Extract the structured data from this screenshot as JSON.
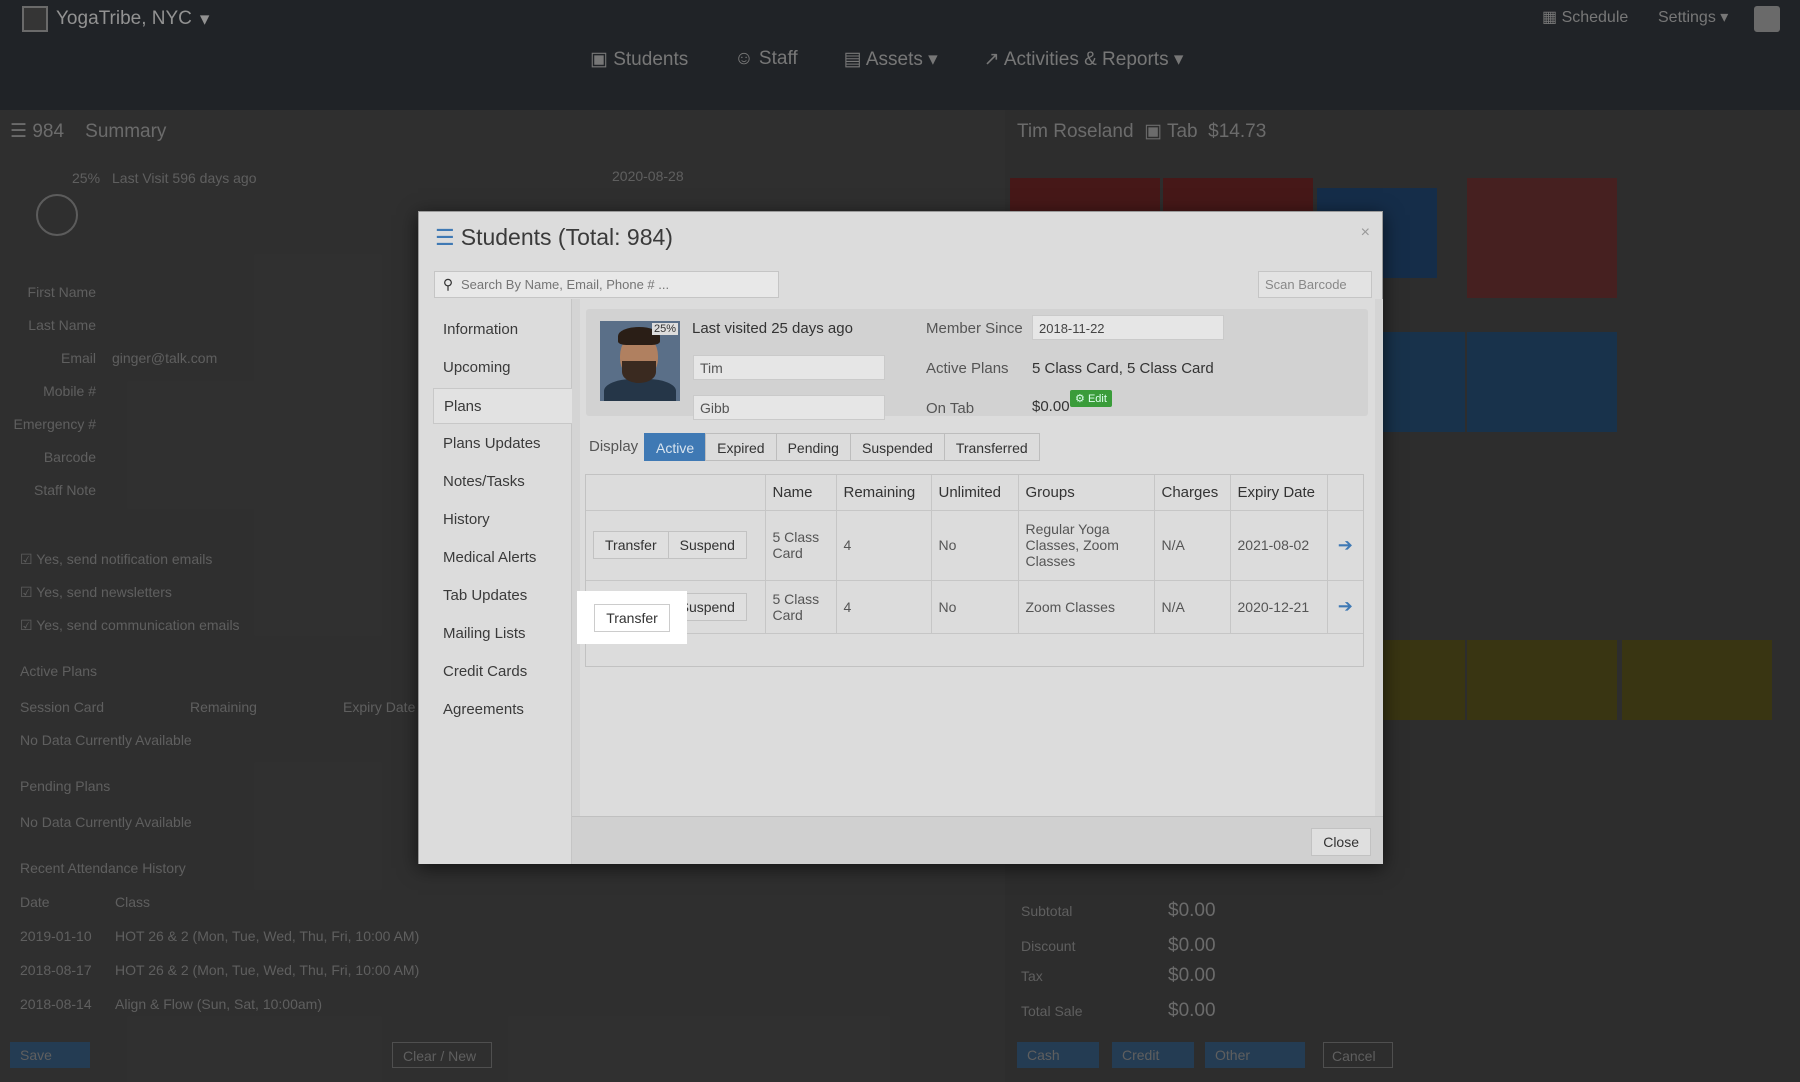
{
  "background": {
    "brand": "YogaTribe, NYC",
    "nav": [
      "Students",
      "Staff",
      "Assets",
      "Activities & Reports"
    ],
    "top_right": [
      "Schedule",
      "Settings"
    ],
    "left_header": {
      "count": "984",
      "title": "Summary"
    },
    "right_header": {
      "name": "Tim Roseland",
      "tab": "Tab",
      "amount": "$14.73"
    },
    "profile_pct": "25%",
    "last_visit": "Last Visit  596 days ago",
    "date": "2020-08-28",
    "fields": [
      "First Name",
      "Last Name",
      "Email",
      "Mobile #",
      "Emergency #",
      "Barcode",
      "Staff Note"
    ],
    "email": "ginger@talk.com",
    "checkboxes": [
      "Yes, send notification emails",
      "Yes, send newsletters",
      "Yes, send communication emails"
    ],
    "active_plans": "Active Plans",
    "plan_cols": [
      "Session Card",
      "Remaining",
      "Expiry Date"
    ],
    "no_data": "No Data Currently Available",
    "pending_plans": "Pending Plans",
    "attendance": "Recent Attendance History",
    "att_cols": [
      "Date",
      "Class"
    ],
    "att_rows": [
      [
        "2019-01-10",
        "HOT 26 & 2 (Mon, Tue, Wed, Thu, Fri, 10:00 AM)"
      ],
      [
        "2018-08-17",
        "HOT 26 & 2 (Mon, Tue, Wed, Thu, Fri, 10:00 AM)"
      ],
      [
        "2018-08-14",
        "Align & Flow (Sun, Sat, 10:00am)"
      ]
    ],
    "save": "Save",
    "clear": "Clear / New",
    "totals_labels": [
      "Subtotal",
      "Discount",
      "Tax",
      "Total Sale"
    ],
    "totals_values": [
      "$0.00",
      "$0.00",
      "$0.00",
      "$0.00"
    ],
    "pay_buttons": [
      "Cash",
      "Credit",
      "Other",
      "Cancel"
    ]
  },
  "modal": {
    "title": "Students (Total: 984)",
    "search_placeholder": "Search By Name, Email, Phone # ...",
    "scan_barcode": "Scan Barcode",
    "menu": [
      "Information",
      "Upcoming",
      "Plans",
      "Plans Updates",
      "Notes/Tasks",
      "History",
      "Medical Alerts",
      "Tab Updates",
      "Mailing Lists",
      "Credit Cards",
      "Agreements"
    ],
    "active_menu": "Plans",
    "profile": {
      "pct": "25%",
      "last_visited": "Last visited 25 days ago",
      "first_name": "Tim",
      "last_name": "Gibb",
      "member_since_label": "Member Since",
      "member_since": "2018-11-22",
      "active_plans_label": "Active Plans",
      "active_plans": "5 Class Card, 5 Class Card",
      "on_tab_label": "On Tab",
      "on_tab": "$0.00",
      "edit": "Edit"
    },
    "display_label": "Display",
    "tabs": [
      "Active",
      "Expired",
      "Pending",
      "Suspended",
      "Transferred"
    ],
    "active_tab": "Active",
    "table": {
      "headers": [
        "",
        "Name",
        "Remaining",
        "Unlimited",
        "Groups",
        "Charges",
        "Expiry Date",
        ""
      ],
      "rows": [
        {
          "transfer": "Transfer",
          "suspend": "Suspend",
          "name": "5 Class Card",
          "remaining": "4",
          "unlimited": "No",
          "groups": "Regular Yoga Classes, Zoom Classes",
          "charges": "N/A",
          "expiry": "2021-08-02"
        },
        {
          "transfer": "Transfer",
          "suspend": "Suspend",
          "name": "5 Class Card",
          "remaining": "4",
          "unlimited": "No",
          "groups": "Zoom Classes",
          "charges": "N/A",
          "expiry": "2020-12-21"
        }
      ]
    },
    "close": "Close",
    "colors": {
      "accent": "#3f79b4",
      "edit": "#3a9c3a"
    }
  }
}
